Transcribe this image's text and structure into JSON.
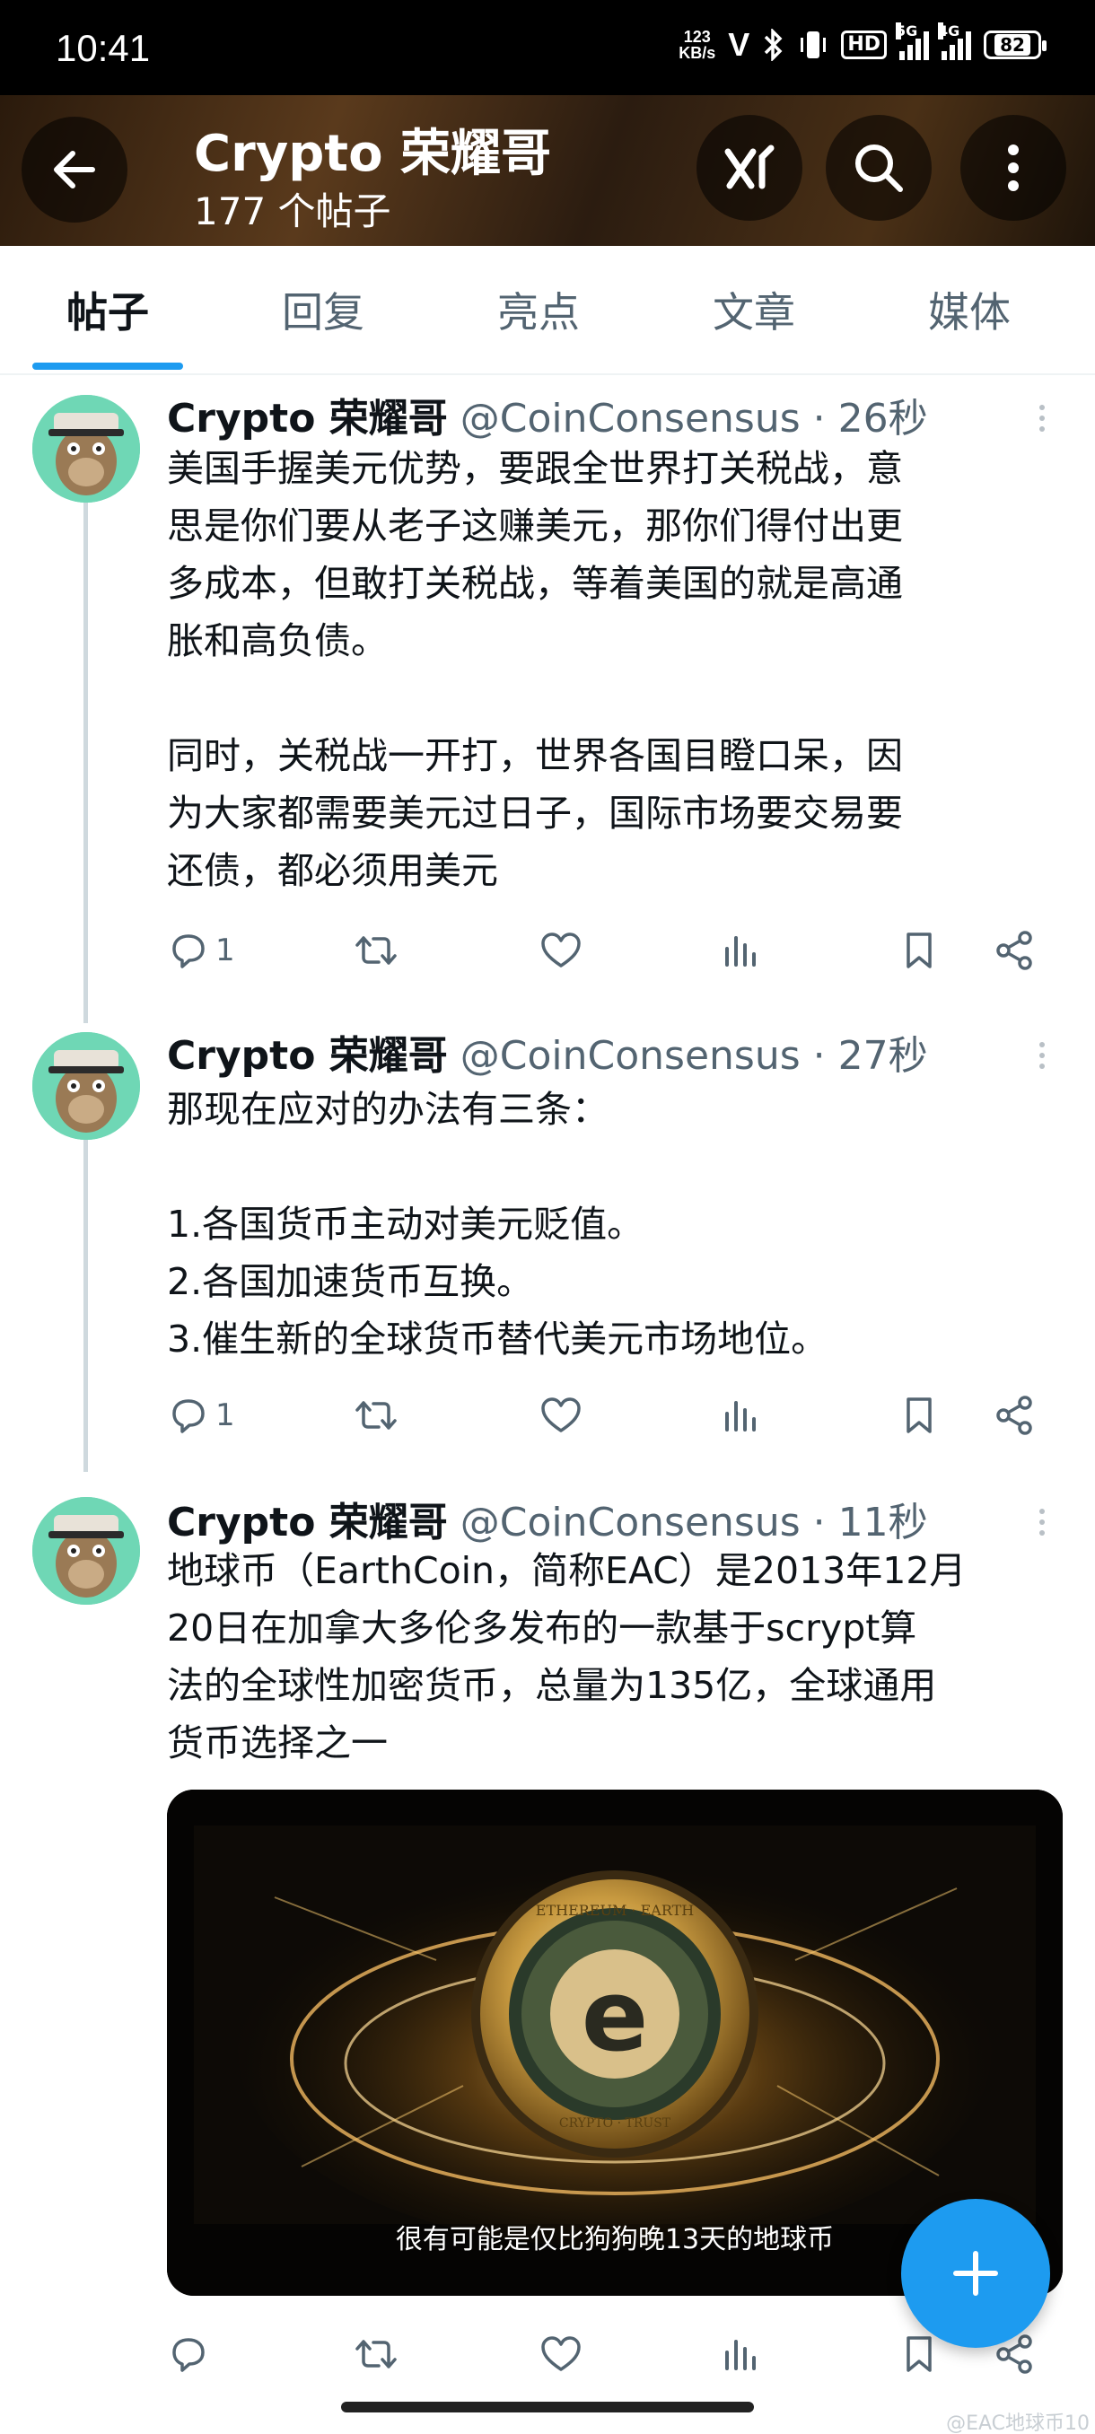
{
  "status_bar": {
    "time": "10:41",
    "net_speed_value": "123",
    "net_speed_unit": "KB/s",
    "hd_label": "HD",
    "sig1_tag": "5G",
    "sig2_tag": "4G",
    "battery": "82"
  },
  "header": {
    "title": "Crypto 荣耀哥",
    "post_count": "177 个帖子"
  },
  "tabs": [
    {
      "label": "帖子",
      "active": true
    },
    {
      "label": "回复",
      "active": false
    },
    {
      "label": "亮点",
      "active": false
    },
    {
      "label": "文章",
      "active": false
    },
    {
      "label": "媒体",
      "active": false
    }
  ],
  "posts": [
    {
      "name": "Crypto 荣耀哥",
      "handle": "@CoinConsensus · 26秒",
      "text": "美国手握美元优势，要跟全世界打关税战，意\n思是你们要从老子这赚美元，那你们得付出更\n多成本，但敢打关税战，等着美国的就是高通\n胀和高负债。\n\n同时，关税战一开打，世界各国目瞪口呆，因\n为大家都需要美元过日子，国际市场要交易要\n还债，都必须用美元",
      "reply_count": "1"
    },
    {
      "name": "Crypto 荣耀哥",
      "handle": "@CoinConsensus · 27秒",
      "text": "那现在应对的办法有三条：\n\n1.各国货币主动对美元贬值。\n2.各国加速货币互换。\n3.催生新的全球货币替代美元市场地位。",
      "reply_count": "1"
    },
    {
      "name": "Crypto 荣耀哥",
      "handle": "@CoinConsensus · 11秒",
      "text": "地球币（EarthCoin，简称EAC）是2013年12月\n20日在加拿大多伦多发布的一款基于scrypt算\n法的全球性加密货币，总量为135亿，全球通用\n货币选择之一",
      "media_caption": "很有可能是仅比狗狗晚13天的地球币",
      "coin_letter": "e",
      "coin_ring_top": "ETHEREUM · EARTH",
      "coin_ring_bottom": "CRYPTO · TRUST"
    }
  ],
  "watermark": "@EAC地球币10"
}
